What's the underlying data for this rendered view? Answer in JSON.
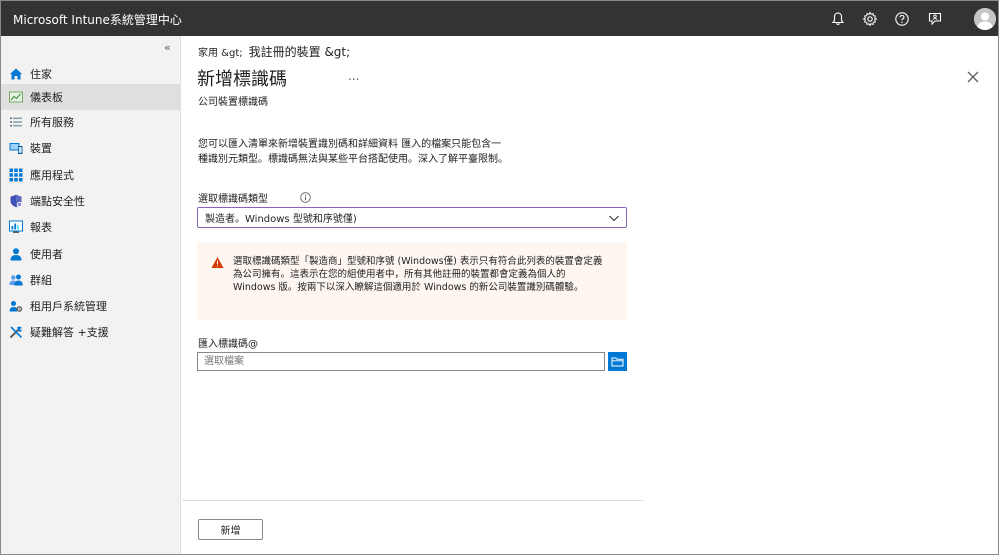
{
  "header": {
    "app_title": "Microsoft Intune系統管理中心",
    "icons": [
      "bell-icon",
      "gear-icon",
      "help-icon",
      "feedback-icon",
      "avatar"
    ]
  },
  "sidebar": {
    "collapse_label": "«",
    "items": [
      {
        "label": "住家",
        "icon": "home-icon"
      },
      {
        "label": "儀表板",
        "icon": "dashboard-icon",
        "active": true
      },
      {
        "label": "所有服務",
        "icon": "list-icon"
      },
      {
        "label": "裝置",
        "icon": "devices-icon"
      },
      {
        "label": "應用程式",
        "icon": "apps-icon"
      },
      {
        "label": "端點安全性",
        "icon": "shield-icon"
      },
      {
        "label": "報表",
        "icon": "reports-icon"
      },
      {
        "label": "使用者",
        "icon": "user-icon"
      },
      {
        "label": "群組",
        "icon": "group-icon"
      },
      {
        "label": "租用戶系統管理",
        "icon": "tenant-admin-icon"
      },
      {
        "label": "疑難解答 +支援",
        "icon": "troubleshoot-icon"
      }
    ]
  },
  "breadcrumb": {
    "item1": "家用 &gt;",
    "item2": "我註冊的裝置 &gt;"
  },
  "main": {
    "title": "新增標識碼",
    "more_label": "...",
    "subtitle": "公司裝置標識碼",
    "description": "您可以匯入清單來新增裝置識別碼和詳細資料 匯入的檔案只能包含一種識別元類型。標識碼無法與某些平台搭配使用。深入了解平臺限制。",
    "type_label": "選取標識碼類型",
    "type_value": "製造者。Windows 型號和序號僅)",
    "warning_text": "選取標識碼類型「製造商」型號和序號 (Windows僅) 表示只有符合此列表的裝置會定義為公司擁有。這表示在您的組使用者中，所有其他註冊的裝置都會定義為個人的 Windows 版。按兩下以深入瞭解這個適用於 Windows 的新公司裝置識別碼體驗。",
    "import_label": "匯入標識碼@",
    "file_placeholder": "選取檔案",
    "add_button": "新增"
  },
  "colors": {
    "topbar": "#333333",
    "sidebar": "#f3f2f1",
    "dropdown_border": "#8764b8",
    "warning_bg": "#fdf6f1",
    "warning_icon": "#d83b01",
    "accent": "#0078d4"
  }
}
